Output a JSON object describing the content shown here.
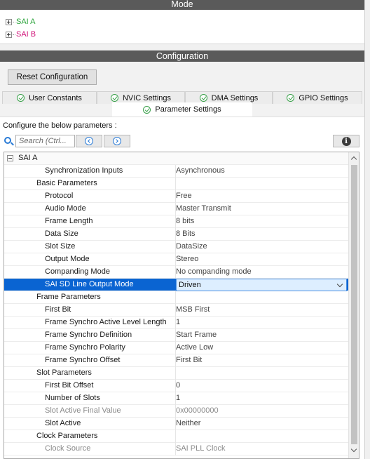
{
  "mode": {
    "title": "Mode",
    "items": [
      {
        "label": "SAI A",
        "color": "#2aa33a"
      },
      {
        "label": "SAI B",
        "color": "#d0147a"
      }
    ]
  },
  "configuration": {
    "title": "Configuration",
    "reset_label": "Reset Configuration",
    "tabs": [
      {
        "label": "User Constants",
        "icon": "check-circle-icon"
      },
      {
        "label": "NVIC Settings",
        "icon": "check-circle-icon"
      },
      {
        "label": "DMA Settings",
        "icon": "check-circle-icon"
      },
      {
        "label": "GPIO Settings",
        "icon": "check-circle-icon"
      },
      {
        "label": "Parameter Settings",
        "icon": "check-circle-icon",
        "active": true
      }
    ],
    "configure_label": "Configure the below parameters :",
    "search_placeholder": "Search (Ctrl...",
    "info_glyph": "i"
  },
  "params": {
    "group": "SAI A",
    "rows": [
      {
        "name": "Synchronization Inputs",
        "value": "Asynchronous",
        "level": 2
      },
      {
        "name": "Basic Parameters",
        "value": "",
        "level": 1
      },
      {
        "name": "Protocol",
        "value": "Free",
        "level": 2
      },
      {
        "name": "Audio Mode",
        "value": "Master Transmit",
        "level": 2
      },
      {
        "name": "Frame Length",
        "value": "8 bits",
        "level": 2
      },
      {
        "name": "Data Size",
        "value": "8 Bits",
        "level": 2
      },
      {
        "name": "Slot Size",
        "value": "DataSize",
        "level": 2
      },
      {
        "name": "Output Mode",
        "value": "Stereo",
        "level": 2
      },
      {
        "name": "Companding Mode",
        "value": "No companding mode",
        "level": 2
      },
      {
        "name": "SAI SD Line Output Mode",
        "value": "Driven",
        "level": 2,
        "selected": true
      },
      {
        "name": "Frame Parameters",
        "value": "",
        "level": 1
      },
      {
        "name": "First Bit",
        "value": "MSB First",
        "level": 2
      },
      {
        "name": "Frame Synchro Active Level Length",
        "value": "1",
        "level": 2
      },
      {
        "name": "Frame Synchro Definition",
        "value": "Start Frame",
        "level": 2
      },
      {
        "name": "Frame Synchro Polarity",
        "value": "Active Low",
        "level": 2
      },
      {
        "name": "Frame Synchro Offset",
        "value": "First Bit",
        "level": 2
      },
      {
        "name": "Slot Parameters",
        "value": "",
        "level": 1
      },
      {
        "name": "First Bit Offset",
        "value": "0",
        "level": 2
      },
      {
        "name": "Number of Slots",
        "value": "1",
        "level": 2
      },
      {
        "name": "Slot Active Final Value",
        "value": "0x00000000",
        "level": 2,
        "disabled": true
      },
      {
        "name": "Slot Active",
        "value": "Neither",
        "level": 2
      },
      {
        "name": "Clock Parameters",
        "value": "",
        "level": 1
      },
      {
        "name": "Clock Source",
        "value": "SAI PLL Clock",
        "level": 2,
        "disabled": true
      }
    ]
  },
  "colors": {
    "header_bg": "#5a5a5a",
    "selection": "#0a64d2",
    "accent_blue": "#2a7bd6",
    "check_green": "#3aa04a"
  }
}
